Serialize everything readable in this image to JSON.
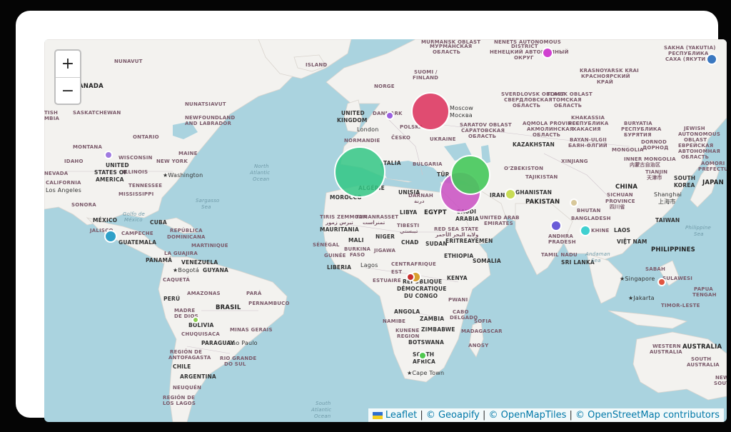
{
  "map": {
    "controls": {
      "zoom_in": "+",
      "zoom_out": "−"
    },
    "attribution": {
      "leaflet": "Leaflet",
      "sep": " | ",
      "geoapify": "© Geoapify",
      "openmaptiles": "© OpenMapTiles",
      "osm": "© OpenStreetMap contributors"
    },
    "labels": {
      "nunavut": "NUNAVUT",
      "canada": "ANADA",
      "nunatsiavut": "NUNATSIAVUT",
      "saskatchewan": "SASKATCHEWAN",
      "tish": "TISH",
      "mbia": "MBIA",
      "newfoundland": "NEWFOUNDLAND",
      "labrador": "AND LABRADOR",
      "ontario": "ONTARIO",
      "montana": "MONTANA",
      "wisconsin": "WISCONSIN",
      "maine": "MAINE",
      "idaho": "IDAHO",
      "newyork": "NEW YORK",
      "usa1": "UNITED",
      "usa2": "STATES OF",
      "usa3": "AMERICA",
      "illinois": "ILLINOIS",
      "washington": "Washington",
      "nevada": "NEVADA",
      "california": "CALIFORNIA",
      "tennessee": "TENNESSEE",
      "losangeles": "Los Angeles",
      "mississippi": "MISSISSIPPI",
      "sonora": "SONORA",
      "mexico": "MÉXICO",
      "golfo1": "Golfo de",
      "golfo2": "México",
      "cuba": "CUBA",
      "jalisco": "JALISCO",
      "campeche": "CAMPECHE",
      "guatemala": "GUATEMALA",
      "republica": "REPÚBLICA",
      "dominicana": "DOMINICANA",
      "martinique": "MARTINIQUE",
      "panama": "PANAMÁ",
      "laguajira": "LA GUAJIRA",
      "venezuela": "VENEZUELA",
      "bogota": "Bogotá",
      "guyana": "GUYANA",
      "caqueta": "CAQUETÁ",
      "amazonas": "AMAZONAS",
      "para": "PARÁ",
      "peru": "PERÚ",
      "brasil": "BRASIL",
      "pernambuco": "PERNAMBUCO",
      "madre1": "MADRE",
      "madre2": "DE DIOS",
      "bolivia": "BOLIVIA",
      "chuquisaca": "CHUQUISACA",
      "minas": "MINAS GERAIS",
      "paraguay": "PARAGUAY",
      "saopaulo": "São Paulo",
      "region1": "REGIÓN DE",
      "region2": "ANTOFAGASTA",
      "chile": "CHILE",
      "riogrande1": "RIO GRANDE",
      "riogrande2": "DO SUL",
      "argentina": "ARGENTINA",
      "neuquen": "NEUQUÉN",
      "reglagos1": "REGIÓN DE",
      "reglagos2": "LOS LAGOS",
      "sargasso1": "Sargasso",
      "sargasso2": "Sea",
      "northatl1": "North",
      "northatl2": "Atlantic",
      "northatl3": "Ocean",
      "southatl1": "South",
      "southatl2": "Atlantic",
      "southatl3": "Ocean",
      "island": "ISLAND",
      "norge": "NORGE",
      "suomi1": "SUOMI /",
      "suomi2": "FINLAND",
      "uk1": "UNITED",
      "uk2": "KINGDOM",
      "danmark": "DANMARK",
      "london": "London",
      "polska": "POLSKA",
      "moscow1": "Moscow",
      "moscow2": "Москва",
      "cesko": "ČESKO",
      "ukraine": "UKRAINE",
      "normandie": "NORMANDIE",
      "italia": "ITALIA",
      "bulgaria": "BULGARIA",
      "espana": "ESPAÑA",
      "morocco": "MOROCCO",
      "algerie": "ALGÉRIE",
      "tunisia": "UNISIA",
      "darnah1": "DARNAH",
      "darnah2": "درنة",
      "tiris1": "TIRIS ZEMMOUR",
      "tiris2": "تيرس زمور",
      "tamanrasset1": "TAMANRASSET",
      "tamanrasset2": "تمنراست",
      "libya": "LIBYA",
      "egypt": "EGYPT",
      "tibesti1": "TIBESTI",
      "tibesti2": "تيبستي",
      "mauritania": "MAURITANIA",
      "mali": "MALI",
      "niger": "NIGER",
      "chad": "CHAD",
      "sudan": "SUDAN",
      "redsea1": "RED SEA STATE",
      "redsea2": "ولاية البحر الأحمر",
      "eritrea": "ERITREA",
      "yemen": "YEMEN",
      "senegal": "SÉNÉGAL",
      "burkina1": "BURKINA",
      "burkina2": "FASO",
      "guinee": "GUINÉE",
      "jigawa": "JIGAWA",
      "ethiopia": "ETHIOPIA",
      "somalia": "SOMALIA",
      "liberia": "LIBERIA",
      "lagos": "Lagos",
      "centrafrique": "CENTRAFRIQUE",
      "est": "EST",
      "estuaire": "ESTUAIRE",
      "kenya": "KENYA",
      "rdc1": "RÉPUBLIQUE",
      "rdc2": "DÉMOCRATIQUE",
      "rdc3": "DU CONGO",
      "pwani": "PWANI",
      "angola": "ANGOLA",
      "zambia": "ZAMBIA",
      "cabo1": "CABO",
      "cabo2": "DELGADO",
      "sofia": "SOFIA",
      "namibe": "NAMIBE",
      "kunene1": "KUNENE",
      "kunene2": "REGION",
      "zimbabwe": "ZIMBABWE",
      "madagascar": "MADAGASCAR",
      "anosy": "ANOSY",
      "botswana": "BOTSWANA",
      "southafrica1": "SOUTH",
      "southafrica2": "AFRICA",
      "capetown": "Cape Town",
      "turkey": "TÜR",
      "saudi1": "SAUDI",
      "saudi2": "ARABIA",
      "uae1": "UNITED ARAB",
      "uae2": "EMIRATES",
      "iran": "IRAN",
      "afghanistan": "GHANISTAN",
      "pakistan": "PAKISTAN",
      "uzbekistan": "O'ZBEKISTON",
      "tajikistan": "TAJIKISTAN",
      "kazakhstan": "KAZAKHSTAN",
      "bhutan": "BHUTAN",
      "bangladesh": "BANGLADESH",
      "andhra1": "ANDHRA",
      "andhra2": "PRADESH",
      "tamilnadu": "TAMIL NADU",
      "srilanka": "SRI LANKA",
      "andaman1": "Andaman",
      "andaman2": "Sea",
      "khine": "KHINE",
      "laos": "LAOS",
      "vietnam": "VIỆT NAM",
      "philippines": "PHILIPPINES",
      "philsea1": "Philippine",
      "philsea2": "Sea",
      "taiwan": "TAIWAN",
      "singapore": "Singapore",
      "jakarta": "Jakarta",
      "sabah": "SABAH",
      "sulawesi": "SULAWESI",
      "papua1": "PAPUA",
      "papua2": "TENGAH",
      "timor": "TIMOR-LESTE",
      "westaus1": "WESTERN",
      "westaus2": "AUSTRALIA",
      "australia": "AUSTRALIA",
      "southaus1": "SOUTH",
      "southaus2": "AUSTRALIA",
      "nsw1": "NEW",
      "nsw2": "SOUTH",
      "china": "CHINA",
      "sichuan1": "SICHUAN",
      "sichuan2": "PROVINCE",
      "sichuan3": "四川省",
      "shanghai1": "Shanghai",
      "shanghai2": "上海市",
      "southkorea1": "SOUTH",
      "southkorea2": "KOREA",
      "japan": "JAPAN",
      "mongolia": "MONGOLIA",
      "innermong1": "INNER MONGOLIA",
      "innermong2": "内蒙古自治区",
      "dornod1": "DORNOD",
      "dornod2": "ДОРНОД",
      "buryatia1": "BURYATIA",
      "buryatia2": "РЕСПУБЛИКА",
      "buryatia3": "БУРЯТИЯ",
      "jewish1": "JEWISH",
      "jewish2": "AUTONOMOUS",
      "jewish3": "OBLAST",
      "jewish4": "ЕВРЕЙСКАЯ",
      "jewish5": "АВТОНОМНАЯ",
      "jewish6": "ОБЛАСТЬ",
      "amori1": "AOMORI",
      "amori2": "PREFECTURE",
      "xinjiang": "XINJIANG",
      "tianjin1": "TIANJIN",
      "tianjin2": "天津市",
      "khakassia1": "KHAKASSIA",
      "khakassia2": "РЕСПУБЛИКА",
      "khakassia3": "ХАКАСИЯ",
      "bayan1": "BAYAN-ULGII",
      "bayan2": "БАЯН-ӨЛГИЙ",
      "aqmola1": "AQMOLA PROVINCE",
      "aqmola2": "АКМОЛИНСКАЯ",
      "aqmola3": "ОБЛАСТЬ",
      "saratov1": "SARATOV OBLAST",
      "saratov2": "САРАТОВСКАЯ",
      "saratov3": "ОБЛАСТЬ",
      "sverd1": "SVERDLOVSK OBLAST",
      "sverd2": "СВЕРДЛОВСКАЯ",
      "sverd3": "ОБЛАСТЬ",
      "tomsk1": "TOMSK OBLAST",
      "tomsk2": "ТОМСКАЯ",
      "tomsk3": "ОБЛАСТЬ",
      "krasno1": "KRASNOYARSK KRAI",
      "krasno2": "КРАСНОЯРСКИЙ",
      "krasno3": "КРАЙ",
      "sakha1": "SAKHA (YAKUTIA)",
      "sakha2": "РЕСПУБЛИКА",
      "sakha3": "САХА (ЯКУТИЯ)",
      "nenets1": "NENETS AUTONOMOUS",
      "nenets2": "DISTRICT",
      "nenets3": "НЕНЕЦКИЙ АВТОНОМНЫЙ",
      "nenets4": "ОКРУГ",
      "murmansk1": "MURMANSK OBLAST",
      "murmansk2": "МУРМАНСКАЯ",
      "murmansk3": "ОБЛАСТЬ",
      "olast": "ОБЛАСТЬ"
    },
    "markers": [
      {
        "name": "europe-large",
        "color": "#dc2f5a"
      },
      {
        "name": "spain-large",
        "color": "#33c785"
      },
      {
        "name": "middle-east-magenta",
        "color": "#c94fc2"
      },
      {
        "name": "middle-east-green",
        "color": "#45c85a"
      },
      {
        "name": "usa-purple",
        "color": "#a07be0"
      },
      {
        "name": "mexico-teal",
        "color": "#2fa0c8"
      },
      {
        "name": "denmark-purple",
        "color": "#9b5fe0"
      },
      {
        "name": "russia-magenta",
        "color": "#d040d0"
      },
      {
        "name": "yakutia-blue",
        "color": "#3a78c0"
      },
      {
        "name": "afghanistan-lime",
        "color": "#c8dc55"
      },
      {
        "name": "china-tan",
        "color": "#d8c89a"
      },
      {
        "name": "india-violet",
        "color": "#6a5cd8"
      },
      {
        "name": "myanmar-cyan",
        "color": "#3fd0d0"
      },
      {
        "name": "congo-orange",
        "color": "#d8a030"
      },
      {
        "name": "congo-red",
        "color": "#c83030"
      },
      {
        "name": "bolivia-green",
        "color": "#8cd050"
      },
      {
        "name": "southafrica-green",
        "color": "#50c850"
      },
      {
        "name": "indonesia-red",
        "color": "#e05540"
      }
    ]
  }
}
